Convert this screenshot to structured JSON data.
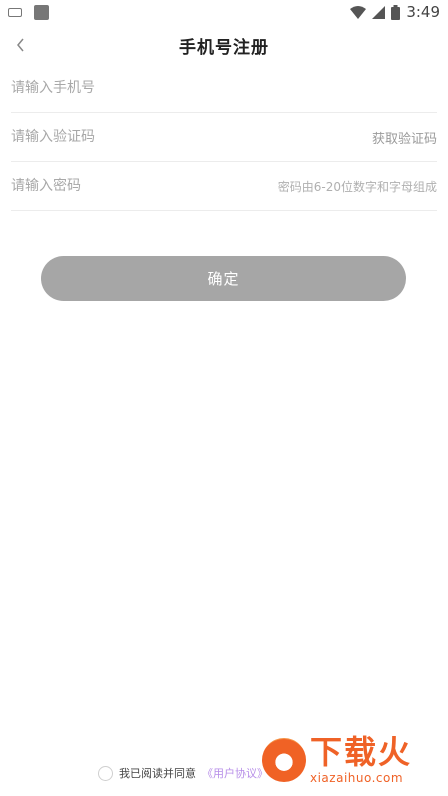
{
  "status_bar": {
    "time": "3:49",
    "battery_level": "full",
    "left_icons": [
      "keyboard-icon",
      "clipboard-icon"
    ]
  },
  "header": {
    "title": "手机号注册",
    "back_icon": "chevron-left-icon"
  },
  "form": {
    "phone": {
      "placeholder": "请输入手机号",
      "value": ""
    },
    "code": {
      "placeholder": "请输入验证码",
      "value": "",
      "get_code_label": "获取验证码"
    },
    "password": {
      "placeholder": "请输入密码",
      "value": "",
      "hint": "密码由6-20位数字和字母组成"
    }
  },
  "confirm_label": "确定",
  "agreement": {
    "text": "我已阅读并同意",
    "link": "《用户协议》",
    "checked": false
  },
  "watermark": {
    "cn": "下载火",
    "en": "xiazaihuo.com"
  },
  "colors": {
    "button_bg": "#a6a6a6",
    "link": "#b78ee8",
    "watermark": "#ef5a1c"
  }
}
